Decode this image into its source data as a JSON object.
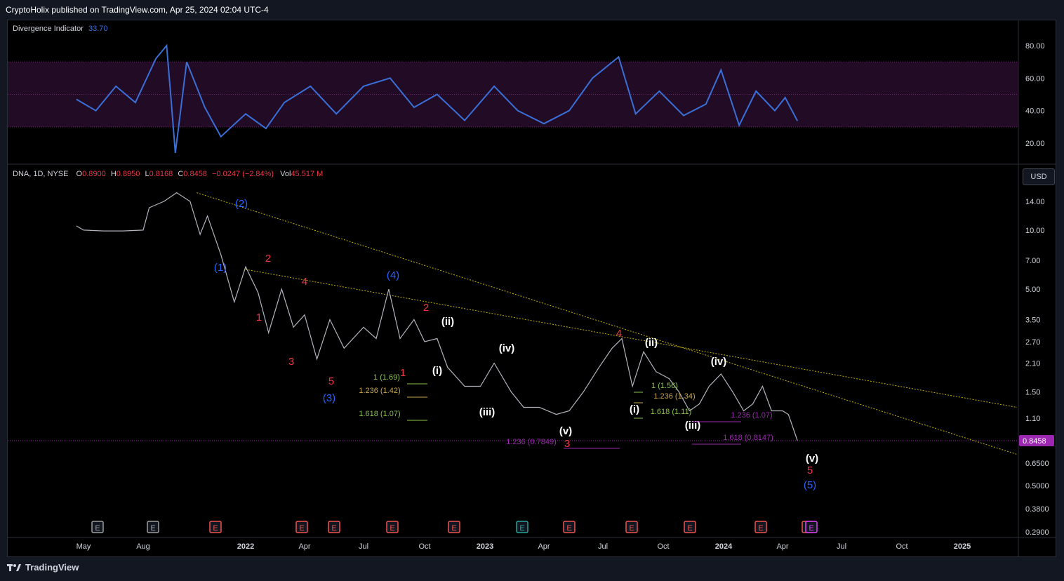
{
  "header": {
    "text": "CryptoHolix published on TradingView.com, Apr 25, 2024 02:04 UTC-4"
  },
  "footer": {
    "brand": "TradingView"
  },
  "currency_button": "USD",
  "indicator": {
    "name": "Divergence Indicator",
    "value": "33.70",
    "y_ticks": [
      "80.00",
      "60.00",
      "40.00",
      "20.00"
    ],
    "color": "#3a6fd8"
  },
  "price_legend": {
    "symbol": "DNA, 1D, NYSE",
    "o_label": "O",
    "o": "0.8900",
    "h_label": "H",
    "h": "0.8950",
    "l_label": "L",
    "l": "0.8168",
    "c_label": "C",
    "c": "0.8458",
    "change": "−0.0247 (−2.84%)",
    "vol_label": "Vol",
    "vol": "45.517 M"
  },
  "price_axis": {
    "ticks": [
      "14.00",
      "10.00",
      "7.00",
      "5.00",
      "3.50",
      "2.70",
      "2.10",
      "1.50",
      "1.10",
      "0.6500",
      "0.5000",
      "0.3800",
      "0.2900"
    ],
    "last_price": "0.8458",
    "last_color": "#9c27b0"
  },
  "time_axis": [
    "May",
    "Aug",
    "2022",
    "Apr",
    "Jul",
    "Oct",
    "2023",
    "Apr",
    "Jul",
    "Oct",
    "2024",
    "Apr",
    "Jul",
    "Oct",
    "2025"
  ],
  "colors": {
    "up": "#26a69a",
    "down": "#ef5350",
    "wave_red": "#f23645",
    "wave_blue": "#2962ff",
    "wave_white": "#ffffff",
    "trend": "#c8b400"
  },
  "wave_labels": [
    {
      "text": "(2)",
      "color": "blue"
    },
    {
      "text": "(1)",
      "color": "blue"
    },
    {
      "text": "2",
      "color": "red"
    },
    {
      "text": "4",
      "color": "red"
    },
    {
      "text": "1",
      "color": "red"
    },
    {
      "text": "3",
      "color": "red"
    },
    {
      "text": "5",
      "color": "red"
    },
    {
      "text": "(3)",
      "color": "blue"
    },
    {
      "text": "(4)",
      "color": "blue"
    },
    {
      "text": "2",
      "color": "red"
    },
    {
      "text": "(ii)",
      "color": "white"
    },
    {
      "text": "1",
      "color": "red"
    },
    {
      "text": "(i)",
      "color": "white"
    },
    {
      "text": "(iv)",
      "color": "white"
    },
    {
      "text": "(iii)",
      "color": "white"
    },
    {
      "text": "(v)",
      "color": "white"
    },
    {
      "text": "3",
      "color": "red"
    },
    {
      "text": "4",
      "color": "red"
    },
    {
      "text": "(ii)",
      "color": "white"
    },
    {
      "text": "(i)",
      "color": "white"
    },
    {
      "text": "(iii)",
      "color": "white"
    },
    {
      "text": "(iv)",
      "color": "white"
    },
    {
      "text": "(v)",
      "color": "white"
    },
    {
      "text": "5",
      "color": "red"
    },
    {
      "text": "(5)",
      "color": "blue"
    }
  ],
  "fib_labels": [
    {
      "text": "1 (1.69)",
      "color": "#8bc34a"
    },
    {
      "text": "1.236 (1.42)",
      "color": "#c8a84b"
    },
    {
      "text": "1.618 (1.07)",
      "color": "#8bc34a"
    },
    {
      "text": "1.236 (0.7849)",
      "color": "#9c27b0"
    },
    {
      "text": "1 (1.56)",
      "color": "#8bc34a"
    },
    {
      "text": "1.236 (1.34)",
      "color": "#c8a84b"
    },
    {
      "text": "1.618 (1.11)",
      "color": "#8bc34a"
    },
    {
      "text": "1.236 (1.07)",
      "color": "#9c27b0"
    },
    {
      "text": "1.618 (0.8147)",
      "color": "#9c27b0"
    }
  ],
  "events": [
    "E",
    "E",
    "E",
    "E",
    "E",
    "E",
    "E",
    "E",
    "E",
    "E",
    "E",
    "E",
    "E",
    "E"
  ],
  "chart_data": {
    "type": "line",
    "title": "",
    "xlabel": "",
    "ylabel": "",
    "y_scale": "log",
    "x_range": [
      "2021-04",
      "2025-03"
    ],
    "ylim": [
      0.29,
      16
    ],
    "series": [
      {
        "values_note": "",
        "points": [
          [
            "2021-04-20",
            10.5
          ],
          [
            "2021-05-01",
            10.0
          ],
          [
            "2021-06-01",
            9.9
          ],
          [
            "2021-07-01",
            9.9
          ],
          [
            "2021-08-01",
            10.0
          ],
          [
            "2021-08-10",
            13.0
          ],
          [
            "2021-09-01",
            14.0
          ],
          [
            "2021-09-20",
            15.5
          ],
          [
            "2021-10-10",
            14.0
          ],
          [
            "2021-10-25",
            9.5
          ],
          [
            "2021-11-05",
            11.8
          ],
          [
            "2021-11-25",
            7.5
          ],
          [
            "2021-12-15",
            4.3
          ],
          [
            "2022-01-01",
            6.5
          ],
          [
            "2022-01-20",
            4.8
          ],
          [
            "2022-02-05",
            3.0
          ],
          [
            "2022-02-25",
            5.0
          ],
          [
            "2022-03-15",
            3.2
          ],
          [
            "2022-04-01",
            3.7
          ],
          [
            "2022-04-20",
            2.2
          ],
          [
            "2022-05-10",
            3.5
          ],
          [
            "2022-06-01",
            2.5
          ],
          [
            "2022-07-01",
            3.2
          ],
          [
            "2022-07-20",
            2.8
          ],
          [
            "2022-08-08",
            5.0
          ],
          [
            "2022-08-25",
            2.8
          ],
          [
            "2022-09-15",
            3.5
          ],
          [
            "2022-10-01",
            2.7
          ],
          [
            "2022-10-20",
            2.8
          ],
          [
            "2022-11-05",
            2.0
          ],
          [
            "2022-12-01",
            1.6
          ],
          [
            "2022-12-25",
            1.6
          ],
          [
            "2023-01-15",
            2.1
          ],
          [
            "2023-02-10",
            1.5
          ],
          [
            "2023-03-01",
            1.25
          ],
          [
            "2023-03-25",
            1.25
          ],
          [
            "2023-04-20",
            1.15
          ],
          [
            "2023-05-10",
            1.2
          ],
          [
            "2023-06-01",
            1.5
          ],
          [
            "2023-06-25",
            2.0
          ],
          [
            "2023-07-15",
            2.5
          ],
          [
            "2023-07-30",
            2.8
          ],
          [
            "2023-08-15",
            1.6
          ],
          [
            "2023-09-01",
            2.4
          ],
          [
            "2023-09-20",
            1.9
          ],
          [
            "2023-10-10",
            1.75
          ],
          [
            "2023-10-25",
            1.5
          ],
          [
            "2023-11-10",
            1.2
          ],
          [
            "2023-11-25",
            1.3
          ],
          [
            "2023-12-10",
            1.6
          ],
          [
            "2023-12-28",
            1.85
          ],
          [
            "2024-01-15",
            1.5
          ],
          [
            "2024-02-01",
            1.2
          ],
          [
            "2024-02-15",
            1.3
          ],
          [
            "2024-03-01",
            1.6
          ],
          [
            "2024-03-15",
            1.2
          ],
          [
            "2024-04-01",
            1.2
          ],
          [
            "2024-04-10",
            1.15
          ],
          [
            "2024-04-24",
            0.8458
          ]
        ]
      },
      {
        "name": "Divergence Indicator",
        "values_note": "",
        "points": [
          [
            "2021-04-20",
            47
          ],
          [
            "2021-05-20",
            40
          ],
          [
            "2021-06-20",
            55
          ],
          [
            "2021-07-20",
            45
          ],
          [
            "2021-08-20",
            72
          ],
          [
            "2021-09-05",
            80
          ],
          [
            "2021-09-12",
            45
          ],
          [
            "2021-09-18",
            14
          ],
          [
            "2021-10-05",
            70
          ],
          [
            "2021-11-01",
            42
          ],
          [
            "2021-11-25",
            24
          ],
          [
            "2022-01-01",
            38
          ],
          [
            "2022-02-01",
            29
          ],
          [
            "2022-03-01",
            45
          ],
          [
            "2022-04-10",
            55
          ],
          [
            "2022-05-20",
            38
          ],
          [
            "2022-07-01",
            55
          ],
          [
            "2022-08-10",
            60
          ],
          [
            "2022-09-15",
            42
          ],
          [
            "2022-10-20",
            50
          ],
          [
            "2022-12-01",
            34
          ],
          [
            "2023-01-15",
            55
          ],
          [
            "2023-02-20",
            40
          ],
          [
            "2023-04-01",
            32
          ],
          [
            "2023-05-10",
            40
          ],
          [
            "2023-06-15",
            60
          ],
          [
            "2023-07-25",
            73
          ],
          [
            "2023-08-20",
            38
          ],
          [
            "2023-09-25",
            52
          ],
          [
            "2023-11-01",
            37
          ],
          [
            "2023-12-05",
            44
          ],
          [
            "2023-12-28",
            65
          ],
          [
            "2024-01-25",
            31
          ],
          [
            "2024-02-20",
            52
          ],
          [
            "2024-03-20",
            40
          ],
          [
            "2024-04-05",
            48
          ],
          [
            "2024-04-24",
            33.7
          ]
        ]
      }
    ],
    "indicator_bands": [
      30,
      50,
      70
    ]
  }
}
